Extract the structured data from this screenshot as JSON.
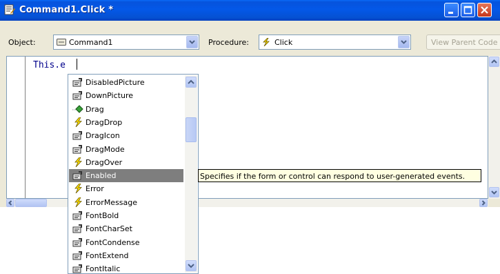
{
  "window": {
    "title": "Command1.Click *"
  },
  "toolbar": {
    "object_label": "Object:",
    "object_value": "Command1",
    "procedure_label": "Procedure:",
    "procedure_value": "Click",
    "view_parent_label": "View Parent Code"
  },
  "editor": {
    "code_line": "This.e"
  },
  "autocomplete": {
    "items": [
      {
        "label": "DisabledPicture",
        "icon": "property-icon"
      },
      {
        "label": "DownPicture",
        "icon": "property-icon"
      },
      {
        "label": "Drag",
        "icon": "method-icon"
      },
      {
        "label": "DragDrop",
        "icon": "event-icon"
      },
      {
        "label": "DragIcon",
        "icon": "property-icon"
      },
      {
        "label": "DragMode",
        "icon": "property-icon"
      },
      {
        "label": "DragOver",
        "icon": "event-icon"
      },
      {
        "label": "Enabled",
        "icon": "property-icon",
        "selected": true
      },
      {
        "label": "Error",
        "icon": "event-icon"
      },
      {
        "label": "ErrorMessage",
        "icon": "event-icon"
      },
      {
        "label": "FontBold",
        "icon": "property-icon"
      },
      {
        "label": "FontCharSet",
        "icon": "property-icon"
      },
      {
        "label": "FontCondense",
        "icon": "property-icon"
      },
      {
        "label": "FontExtend",
        "icon": "property-icon"
      },
      {
        "label": "FontItalic",
        "icon": "property-icon"
      }
    ]
  },
  "tooltip": {
    "text": "Specifies if the form or control can respond to user-generated events."
  },
  "colors": {
    "titlebar": "#0054e3",
    "selection": "#7e7e7e",
    "tooltip_bg": "#ffffe1",
    "code_text": "#00008b"
  }
}
